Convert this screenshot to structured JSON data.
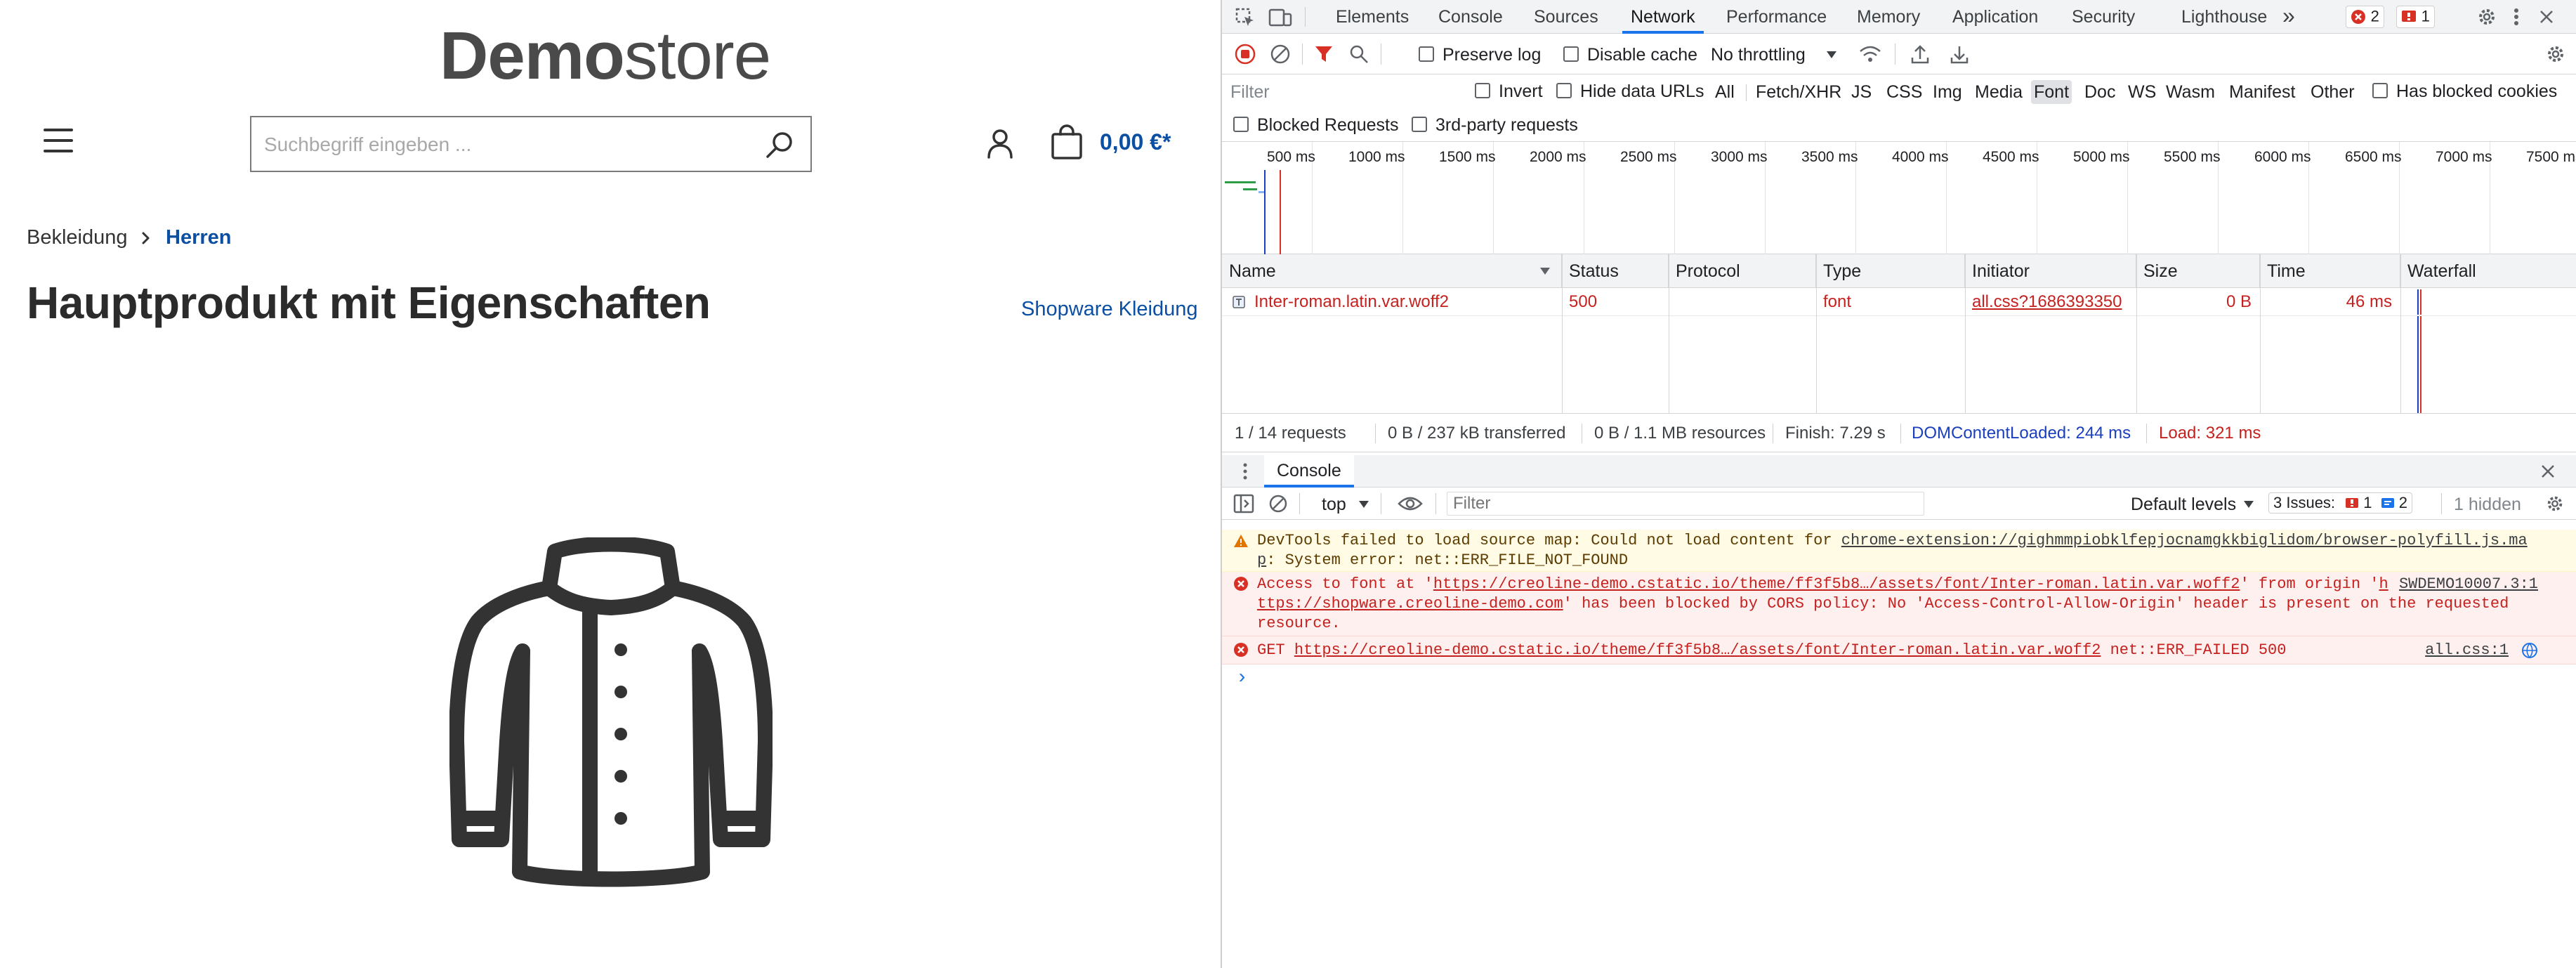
{
  "store": {
    "logo_bold": "Demo",
    "logo_light": "store",
    "search_placeholder": "Suchbegriff eingeben ...",
    "cart_value": "0,00 €*",
    "breadcrumb": [
      "Bekleidung",
      "Herren"
    ],
    "product_title": "Hauptprodukt mit Eigenschaften",
    "manufacturer": "Shopware Kleidung"
  },
  "devtools": {
    "tabs": [
      "Elements",
      "Console",
      "Sources",
      "Network",
      "Performance",
      "Memory",
      "Application",
      "Security",
      "Lighthouse"
    ],
    "active_tab": "Network",
    "more_tabs": "»",
    "error_count": "2",
    "warning_count": "1",
    "toolbar": {
      "preserve_log": "Preserve log",
      "disable_cache": "Disable cache",
      "throttling": "No throttling"
    },
    "filter": {
      "placeholder": "Filter",
      "invert": "Invert",
      "hide_data_urls": "Hide data URLs",
      "types": [
        "All",
        "Fetch/XHR",
        "JS",
        "CSS",
        "Img",
        "Media",
        "Font",
        "Doc",
        "WS",
        "Wasm",
        "Manifest",
        "Other"
      ],
      "selected_type": "Font",
      "has_blocked_cookies": "Has blocked cookies",
      "blocked_requests": "Blocked Requests",
      "third_party": "3rd-party requests"
    },
    "timeline_ticks": [
      "500 ms",
      "1000 ms",
      "1500 ms",
      "2000 ms",
      "2500 ms",
      "3000 ms",
      "3500 ms",
      "4000 ms",
      "4500 ms",
      "5000 ms",
      "5500 ms",
      "6000 ms",
      "6500 ms",
      "7000 ms",
      "7500 ms"
    ],
    "columns": [
      "Name",
      "Status",
      "Protocol",
      "Type",
      "Initiator",
      "Size",
      "Time",
      "Waterfall"
    ],
    "rows": [
      {
        "name": "Inter-roman.latin.var.woff2",
        "status": "500",
        "protocol": "",
        "type": "font",
        "initiator": "all.css?1686393350",
        "size": "0 B",
        "time": "46 ms"
      }
    ],
    "summary": {
      "requests": "1 / 14 requests",
      "transferred": "0 B / 237 kB transferred",
      "resources": "0 B / 1.1 MB resources",
      "finish": "Finish: 7.29 s",
      "dcl": "DOMContentLoaded: 244 ms",
      "load": "Load: 321 ms"
    },
    "console": {
      "title": "Console",
      "context": "top",
      "filter_placeholder": "Filter",
      "levels": "Default levels",
      "issues_label": "3 Issues:",
      "issues_err": "1",
      "issues_info": "2",
      "hidden": "1 hidden",
      "messages": {
        "warn_l1_pre": "DevTools failed to load source map: Could not load content for ",
        "warn_l1_link": "chrome-extension://gighmmpiobklfepjocnamgkkbiglidom/browser-polyfill.js.ma",
        "warn_l2_link": "p",
        "warn_l2_post": ": System error: net::ERR_FILE_NOT_FOUND",
        "cors_l1_pre": "Access to font at '",
        "cors_l1_link": "https://creoline-demo.cstatic.io/theme/ff3f5b8…/assets/font/Inter-roman.latin.var.woff2",
        "cors_l1_post": "' from origin '",
        "cors_l1_tail": "h",
        "cors_src": "SWDEMO10007.3:1",
        "cors_l2_link": "ttps://shopware.creoline-demo.com",
        "cors_l2_post": "' has been blocked by CORS policy: No 'Access-Control-Allow-Origin' header is present on the requested",
        "cors_l3": "resource.",
        "get_pre": "GET ",
        "get_link": "https://creoline-demo.cstatic.io/theme/ff3f5b8…/assets/font/Inter-roman.latin.var.woff2",
        "get_post": " net::ERR_FAILED 500",
        "get_src": "all.css:1"
      },
      "prompt": "›"
    }
  }
}
